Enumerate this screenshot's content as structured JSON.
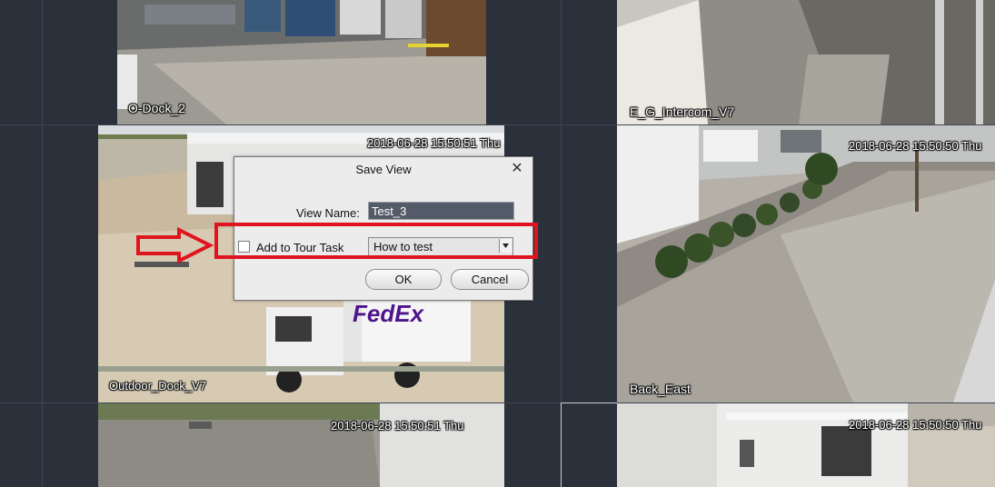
{
  "cameras": [
    {
      "name": "O-Dock_2",
      "timestamp": ""
    },
    {
      "name": "E_G_Intercom_V7",
      "timestamp": ""
    },
    {
      "name": "Outdoor_Dock_V7",
      "timestamp": "2018-06-28 15:50:51 Thu"
    },
    {
      "name": "Back_East",
      "timestamp": "2018-06-28 15:50:50 Thu"
    },
    {
      "name": "",
      "timestamp": "2018-06-28 15:50:51 Thu"
    },
    {
      "name": "",
      "timestamp": "2018-06-28 15:50:50 Thu"
    }
  ],
  "truck_logo": "FedEx",
  "dialog": {
    "title": "Save View",
    "close_glyph": "✕",
    "view_name_label": "View Name:",
    "view_name_value": "Test_3",
    "tour_checkbox_label": "Add to Tour Task",
    "tour_checkbox_checked": false,
    "tour_select_value": "How to test",
    "ok_label": "OK",
    "cancel_label": "Cancel"
  },
  "annotation": {
    "color": "#e0141e",
    "arrow_icon": "right-arrow-outline-icon",
    "box": "highlight-rectangle"
  },
  "theme": {
    "background": "#2b313b",
    "input_background": "#545b68"
  }
}
